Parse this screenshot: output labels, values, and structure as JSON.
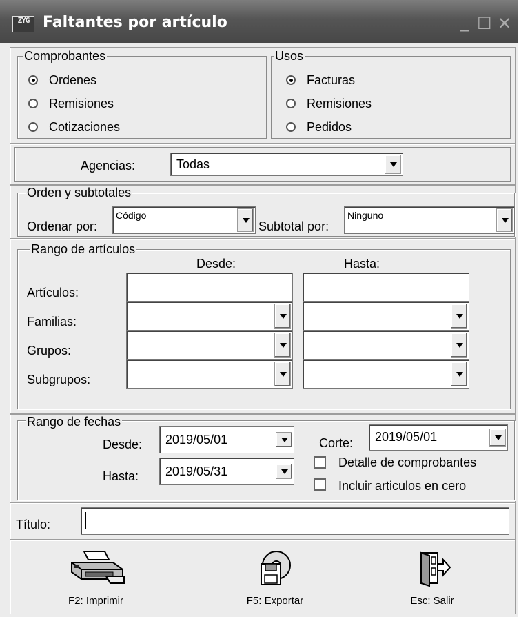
{
  "window": {
    "title": "Faltantes por artículo",
    "icon_text": "ZYG"
  },
  "comprobantes": {
    "legend": "Comprobantes",
    "options": [
      "Ordenes",
      "Remisiones",
      "Cotizaciones"
    ],
    "selected": "Ordenes"
  },
  "usos": {
    "legend": "Usos",
    "options": [
      "Facturas",
      "Remisiones",
      "Pedidos"
    ],
    "selected": "Facturas"
  },
  "agencias": {
    "label": "Agencias:",
    "value": "Todas"
  },
  "orden": {
    "legend": "Orden y subtotales",
    "ordenar_label": "Ordenar por:",
    "ordenar_value": "Código",
    "subtotal_label": "Subtotal por:",
    "subtotal_value": "Ninguno"
  },
  "rango_articulos": {
    "legend": "Rango de artículos",
    "desde_header": "Desde:",
    "hasta_header": "Hasta:",
    "rows": [
      "Artículos:",
      "Familias:",
      "Grupos:",
      "Subgrupos:"
    ]
  },
  "rango_fechas": {
    "legend": "Rango de fechas",
    "desde_label": "Desde:",
    "desde_value": "2019/05/01",
    "hasta_label": "Hasta:",
    "hasta_value": "2019/05/31",
    "corte_label": "Corte:",
    "corte_value": "2019/05/01",
    "detalle_label": "Detalle de comprobantes",
    "incluir_label": "Incluir articulos en cero"
  },
  "titulo": {
    "label": "Título:",
    "value": ""
  },
  "actions": {
    "print": "F2: Imprimir",
    "export": "F5: Exportar",
    "exit": "Esc: Salir"
  },
  "icons": [
    "printer-icon",
    "export-disk-icon",
    "exit-door-icon",
    "minimize-icon",
    "maximize-icon",
    "close-icon"
  ]
}
